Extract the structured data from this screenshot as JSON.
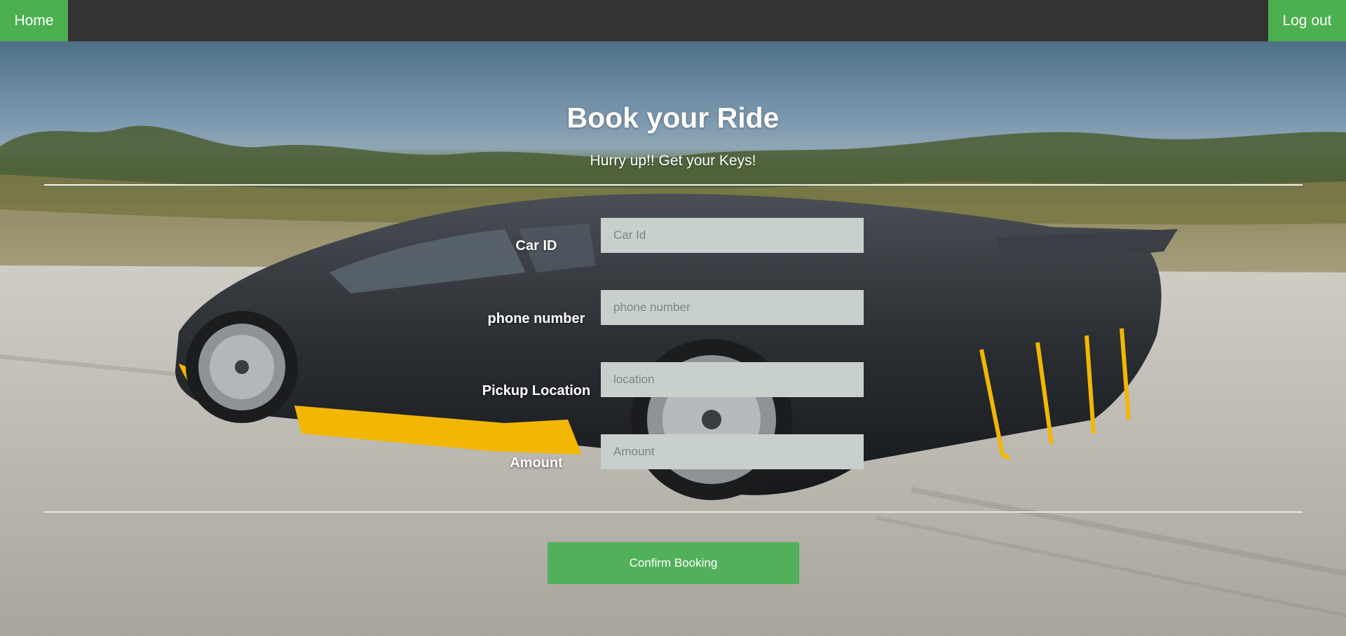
{
  "navbar": {
    "home_label": "Home",
    "logout_label": "Log out"
  },
  "header": {
    "title": "Book your Ride",
    "subtitle": "Hurry up!! Get your Keys!"
  },
  "form": {
    "fields": [
      {
        "label": "Car ID",
        "placeholder": "Car Id",
        "value": ""
      },
      {
        "label": "phone number",
        "placeholder": "phone number",
        "value": ""
      },
      {
        "label": "Pickup Location",
        "placeholder": "location",
        "value": ""
      },
      {
        "label": "Amount",
        "placeholder": "Amount",
        "value": ""
      }
    ],
    "submit_label": "Confirm Booking"
  },
  "colors": {
    "navbar": "#333333",
    "accent": "#4caf50",
    "input_bg": "#c8d0ce"
  }
}
